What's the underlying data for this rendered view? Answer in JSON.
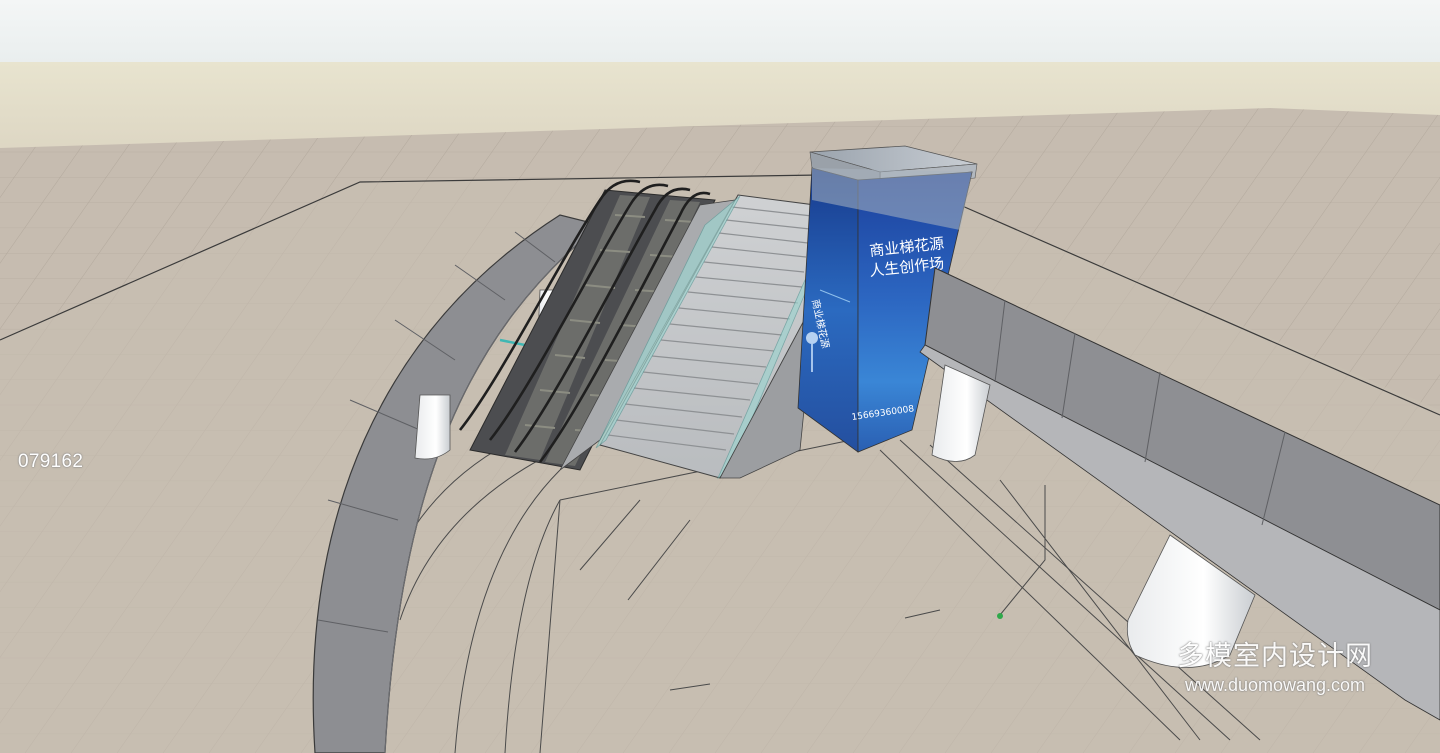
{
  "model_id": "079162",
  "watermark": {
    "chinese": "多模室内设计网",
    "url": "www.duomowang.com"
  },
  "sign": {
    "headline_line1": "商业梯花源",
    "headline_line2": "人生创作场",
    "side_text": "商业梯花源",
    "phone": "15669360008"
  },
  "colors": {
    "sky": "#eef2f2",
    "horizon": "#e6e0cb",
    "floor": "#c4b9ad",
    "wall": "#8f9094",
    "sign_blue": "#1e4fa8",
    "glass": "#9fd3cf"
  }
}
